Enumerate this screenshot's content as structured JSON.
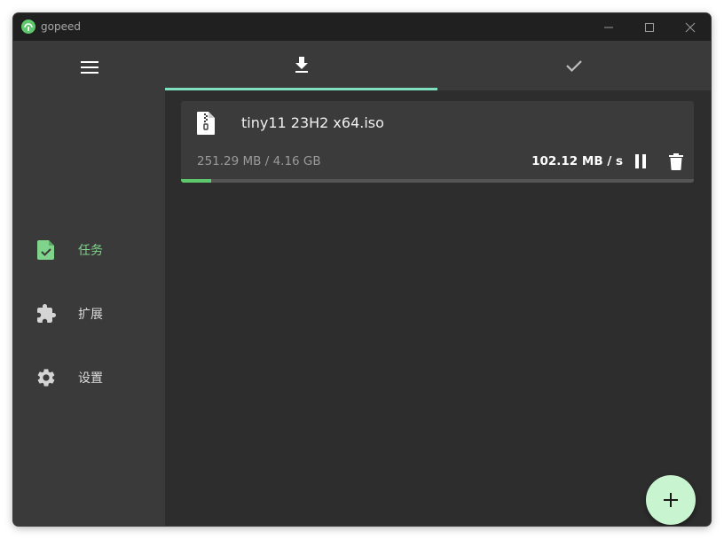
{
  "window": {
    "title": "gopeed"
  },
  "sidebar": {
    "menu_icon": "hamburger-menu-icon",
    "items": [
      {
        "label": "任务",
        "icon": "task-file-check-icon",
        "active": true
      },
      {
        "label": "扩展",
        "icon": "puzzle-extension-icon",
        "active": false
      },
      {
        "label": "设置",
        "icon": "gear-icon",
        "active": false
      }
    ]
  },
  "tabs": [
    {
      "icon": "download-icon",
      "active": true
    },
    {
      "icon": "checkmark-icon",
      "active": false
    }
  ],
  "tasks": [
    {
      "name": "tiny11 23H2 x64.iso",
      "icon": "zip-file-icon",
      "size_progress": "251.29 MB / 4.16 GB",
      "speed": "102.12 MB / s",
      "progress": 0.059
    }
  ],
  "colors": {
    "accent": "#7fd38b",
    "tab_indicator": "#7fe0c0",
    "progress": "#5ec86c",
    "fab": "#c8f5cf"
  }
}
